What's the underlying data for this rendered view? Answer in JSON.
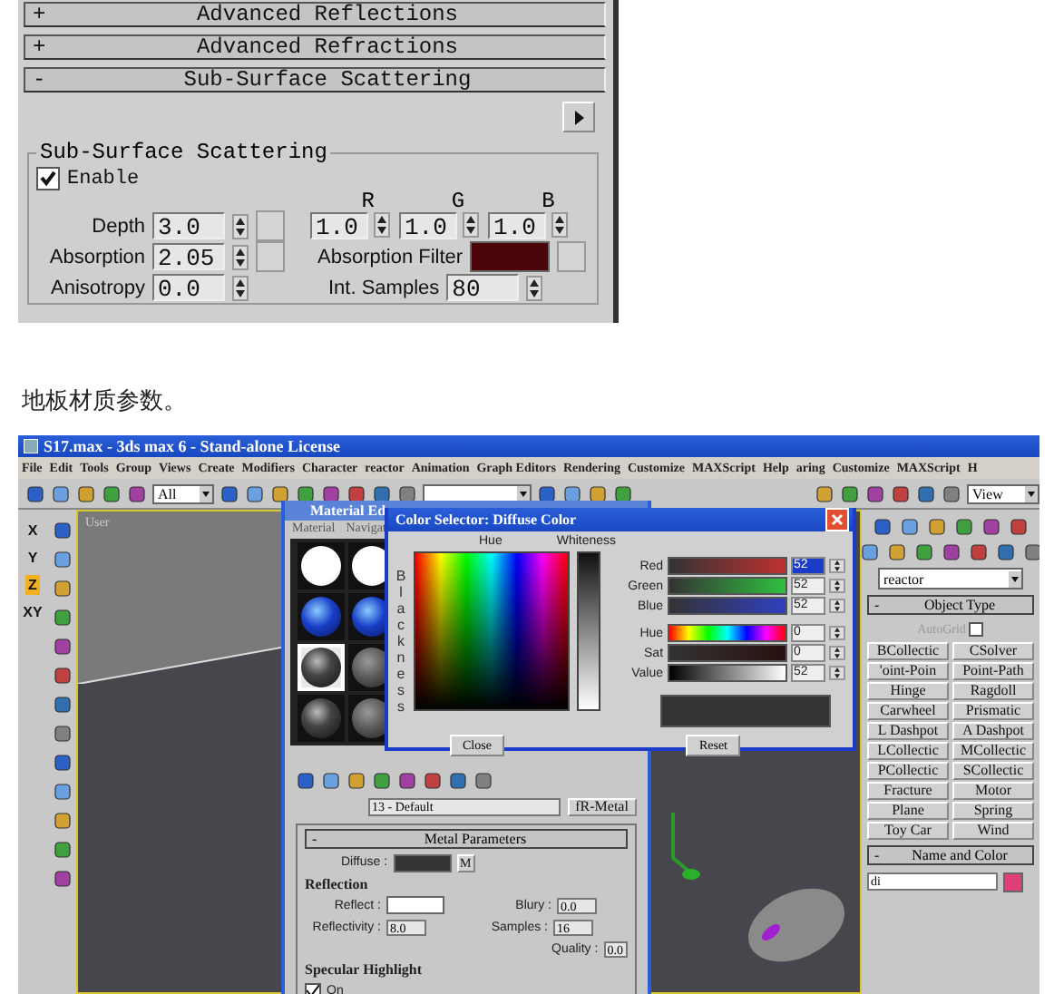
{
  "sss_panel": {
    "rollouts": [
      {
        "sign": "+",
        "title": "Advanced Reflections"
      },
      {
        "sign": "+",
        "title": "Advanced Refractions"
      },
      {
        "sign": "-",
        "title": "Sub-Surface Scattering"
      }
    ],
    "group_title": "Sub-Surface Scattering",
    "enable": {
      "label": "Enable",
      "checked": true
    },
    "rgb_headers": [
      "R",
      "G",
      "B"
    ],
    "rgb_values": [
      "1.0",
      "1.0",
      "1.0"
    ],
    "rows": [
      {
        "label": "Depth",
        "value": "3.0"
      },
      {
        "label": "Absorption",
        "value": "2.05"
      },
      {
        "label": "Anisotropy",
        "value": "0.0"
      }
    ],
    "absorption_filter": {
      "label": "Absorption Filter",
      "color": "#4a0608"
    },
    "int_samples": {
      "label": "Int. Samples",
      "value": "80"
    }
  },
  "caption": "地板材质参数。",
  "max_window": {
    "title": "S17.max - 3ds max 6 - Stand-alone License",
    "menu": [
      "File",
      "Edit",
      "Tools",
      "Group",
      "Views",
      "Create",
      "Modifiers",
      "Character",
      "reactor",
      "Animation",
      "Graph Editors",
      "Rendering",
      "Customize",
      "MAXScript",
      "Help",
      "aring",
      "Customize",
      "MAXScript",
      "H"
    ],
    "selection_filter": "All",
    "reference_coord": "View",
    "axes": [
      {
        "label": "X",
        "selected": false
      },
      {
        "label": "Y",
        "selected": false
      },
      {
        "label": "Z",
        "selected": true
      },
      {
        "label": "XY",
        "selected": false
      }
    ],
    "viewport_label": "User",
    "command_panel": {
      "category": "reactor",
      "object_type": {
        "sign": "-",
        "title": "Object Type",
        "autogrid": {
          "label": "AutoGrid",
          "checked": false
        },
        "buttons": [
          "BCollectic",
          "CSolver",
          "'oint-Poin",
          "Point-Path",
          "Hinge",
          "Ragdoll",
          "Carwheel",
          "Prismatic",
          "L Dashpot",
          "A Dashpot",
          "LCollectic",
          "MCollectic",
          "PCollectic",
          "SCollectic",
          "Fracture",
          "Motor",
          "Plane",
          "Spring",
          "Toy Car",
          "Wind"
        ]
      },
      "name_and_color": {
        "sign": "-",
        "title": "Name and Color",
        "name": "di",
        "color": "#e0407a"
      }
    },
    "material_editor": {
      "title": "Material Ed",
      "menu": [
        "Material",
        "Navigat"
      ],
      "slots": [
        {
          "kind": "white",
          "selected": false
        },
        {
          "kind": "white",
          "selected": false
        },
        {
          "kind": "blue",
          "selected": false
        },
        {
          "kind": "blue",
          "selected": false
        },
        {
          "kind": "dark",
          "selected": true
        },
        {
          "kind": "gray",
          "selected": false
        },
        {
          "kind": "dark",
          "selected": false
        },
        {
          "kind": "gray",
          "selected": false
        }
      ],
      "material_name": "13 - Default",
      "material_type": "fR-Metal",
      "rollout": {
        "sign": "-",
        "title": "Metal Parameters"
      },
      "diffuse": {
        "label": "Diffuse :",
        "map_button": "M"
      },
      "reflection": {
        "title": "Reflection",
        "reflect": "Reflect :",
        "reflectivity": {
          "label": "Reflectivity :",
          "value": "8.0"
        },
        "blury": {
          "label": "Blury :",
          "value": "0.0"
        },
        "samples": {
          "label": "Samples :",
          "value": "16"
        },
        "quality": {
          "label": "Quality :",
          "value": "0.0"
        }
      },
      "specular": {
        "title": "Specular Highlight",
        "on": {
          "label": "On",
          "checked": true
        }
      }
    },
    "color_selector": {
      "title": "Color Selector: Diffuse Color",
      "hue_label": "Hue",
      "whiteness_label": "Whiteness",
      "blackness_label": "Blackness",
      "channels": [
        {
          "kind": "red",
          "label": "Red",
          "value": "52",
          "selected": true
        },
        {
          "kind": "green",
          "label": "Green",
          "value": "52",
          "selected": false
        },
        {
          "kind": "blue",
          "label": "Blue",
          "value": "52",
          "selected": false
        },
        {
          "kind": "hue",
          "label": "Hue",
          "value": "0",
          "selected": false
        },
        {
          "kind": "sat",
          "label": "Sat",
          "value": "0",
          "selected": false
        },
        {
          "kind": "value",
          "label": "Value",
          "value": "52",
          "selected": false
        }
      ],
      "buttons": [
        "Close",
        "Reset"
      ]
    }
  }
}
